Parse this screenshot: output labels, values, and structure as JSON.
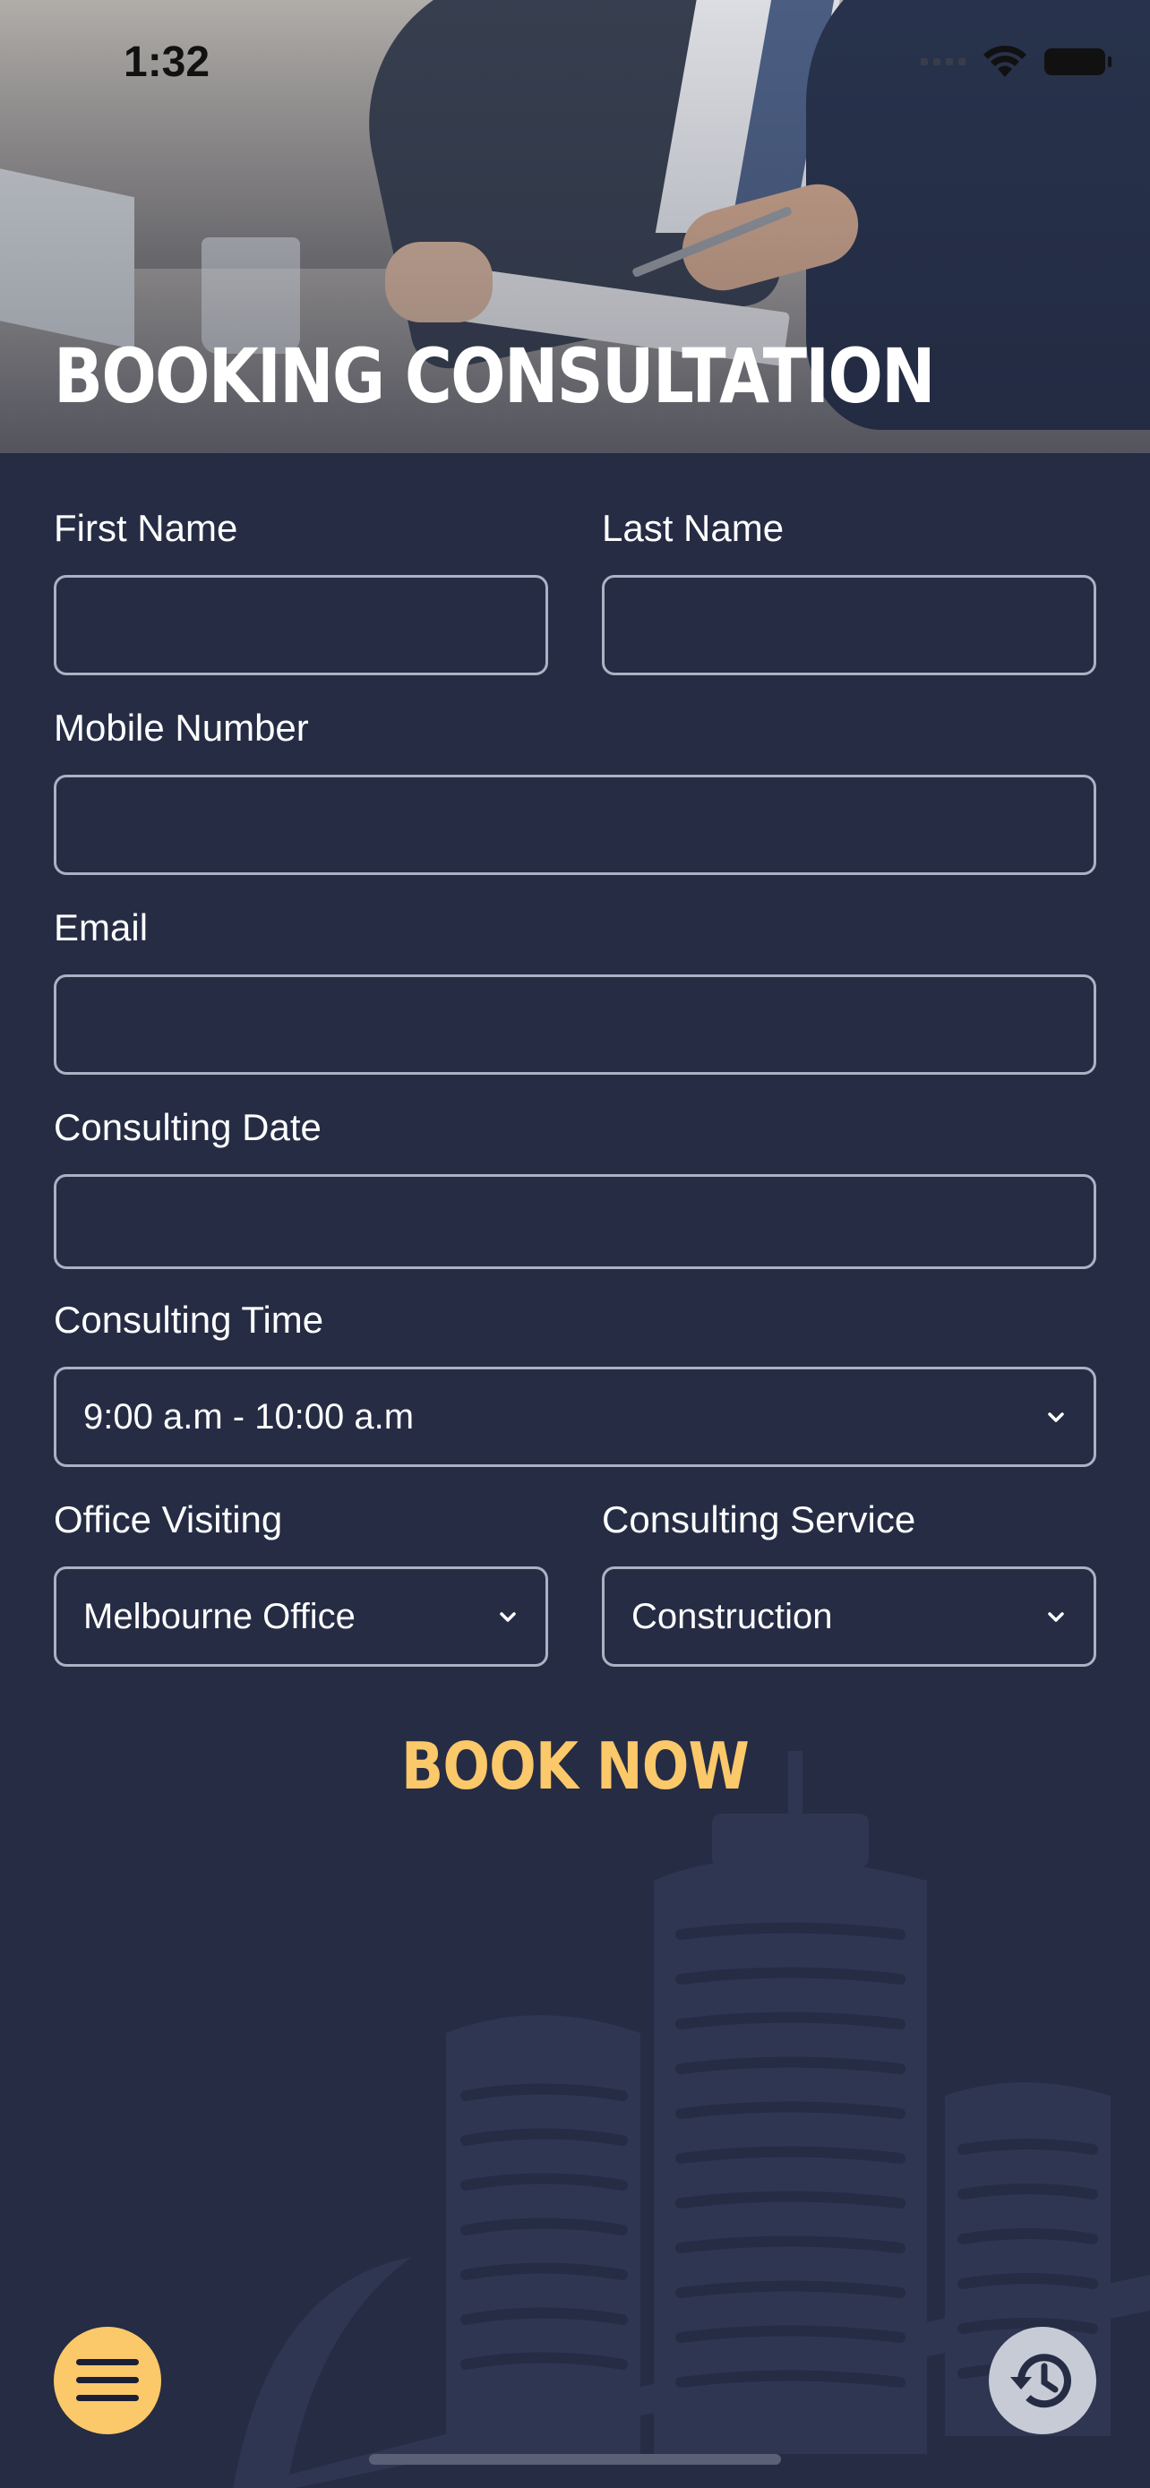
{
  "status_bar": {
    "time": "1:32"
  },
  "header": {
    "title": "BOOKING CONSULTATION"
  },
  "form": {
    "first_name": {
      "label": "First Name",
      "value": ""
    },
    "last_name": {
      "label": "Last Name",
      "value": ""
    },
    "mobile": {
      "label": "Mobile Number",
      "value": ""
    },
    "email": {
      "label": "Email",
      "value": ""
    },
    "date": {
      "label": "Consulting Date",
      "value": ""
    },
    "time": {
      "label": "Consulting Time",
      "selected": "9:00 a.m - 10:00 a.m"
    },
    "office": {
      "label": "Office Visiting",
      "selected": "Melbourne Office"
    },
    "service": {
      "label": "Consulting Service",
      "selected": "Construction"
    },
    "submit_label": "BOOK NOW"
  },
  "footer": {
    "menu_icon": "hamburger-menu-icon",
    "history_icon": "history-icon"
  },
  "colors": {
    "background": "#252c44",
    "accent": "#fbc86a",
    "field_border": "#aab2c4"
  }
}
